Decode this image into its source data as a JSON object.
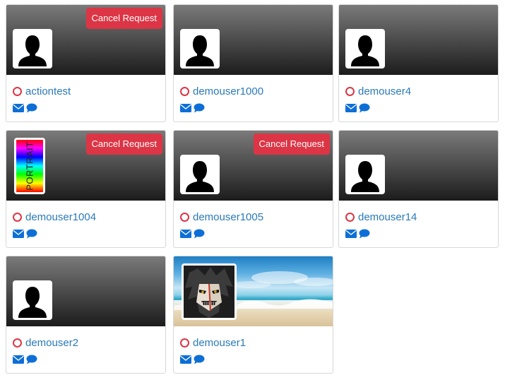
{
  "actions": {
    "cancel_request_label": "Cancel Request",
    "icon_color": "#0d6fd6",
    "cancel_color": "#dc3545",
    "status_color": "#dc3545"
  },
  "cards": [
    {
      "username": "actiontest",
      "pending_request": true,
      "avatar": "silhouette",
      "cover": "dark-gradient"
    },
    {
      "username": "demouser1000",
      "pending_request": false,
      "avatar": "silhouette",
      "cover": "dark-gradient"
    },
    {
      "username": "demouser4",
      "pending_request": false,
      "avatar": "silhouette",
      "cover": "dark-gradient"
    },
    {
      "username": "demouser1004",
      "pending_request": true,
      "avatar": "portrait-rainbow",
      "avatar_text": "PORTRAIT",
      "cover": "dark-gradient"
    },
    {
      "username": "demouser1005",
      "pending_request": true,
      "avatar": "silhouette",
      "cover": "dark-gradient"
    },
    {
      "username": "demouser14",
      "pending_request": false,
      "avatar": "silhouette",
      "cover": "dark-gradient"
    },
    {
      "username": "demouser2",
      "pending_request": false,
      "avatar": "silhouette",
      "cover": "dark-gradient"
    },
    {
      "username": "demouser1",
      "pending_request": false,
      "avatar": "anime-character",
      "cover": "beach-photo"
    }
  ]
}
